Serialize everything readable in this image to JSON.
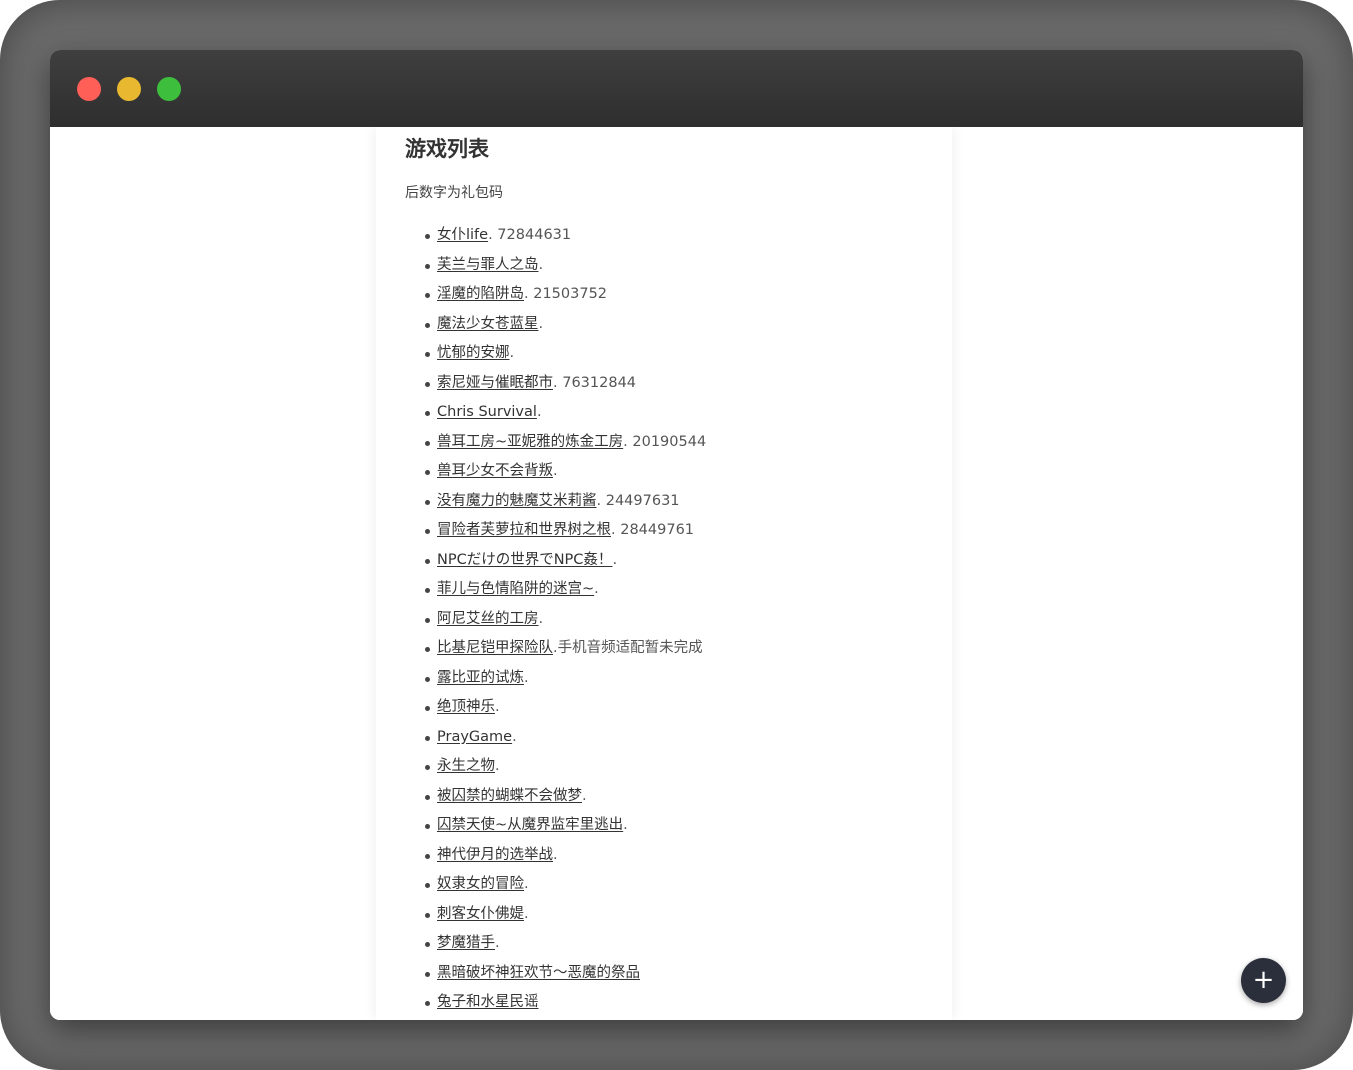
{
  "window": {
    "controls": [
      "close",
      "minimize",
      "maximize"
    ]
  },
  "content": {
    "heading": "游戏列表",
    "note": "后数字为礼包码",
    "games": [
      {
        "title": "女仆life",
        "suffix": ". 72844631"
      },
      {
        "title": "芙兰与罪人之岛",
        "suffix": "."
      },
      {
        "title": "淫魔的陷阱岛",
        "suffix": ". 21503752"
      },
      {
        "title": "魔法少女苍蓝星",
        "suffix": "."
      },
      {
        "title": "忧郁的安娜",
        "suffix": "."
      },
      {
        "title": "索尼娅与催眠都市",
        "suffix": ". 76312844"
      },
      {
        "title": "Chris Survival",
        "suffix": "."
      },
      {
        "title": "兽耳工房~亚妮雅的炼金工房",
        "suffix": ". 20190544"
      },
      {
        "title": "兽耳少女不会背叛",
        "suffix": "."
      },
      {
        "title": "没有魔力的魅魔艾米莉酱",
        "suffix": ". 24497631"
      },
      {
        "title": "冒险者芙萝拉和世界树之根",
        "suffix": ". 28449761"
      },
      {
        "title": "NPCだけの世界でNPC姦！",
        "suffix": "."
      },
      {
        "title": "菲儿与色情陷阱的迷宫~",
        "suffix": "."
      },
      {
        "title": "阿尼艾丝的工房",
        "suffix": "."
      },
      {
        "title": "比基尼铠甲探险队",
        "suffix": ".手机音频适配暂未完成"
      },
      {
        "title": "露比亚的试炼",
        "suffix": "."
      },
      {
        "title": "绝顶神乐",
        "suffix": "."
      },
      {
        "title": "PrayGame",
        "suffix": "."
      },
      {
        "title": "永生之物",
        "suffix": "."
      },
      {
        "title": "被囚禁的蝴蝶不会做梦",
        "suffix": "."
      },
      {
        "title": "囚禁天使~从魔界监牢里逃出",
        "suffix": "."
      },
      {
        "title": "神代伊月的选举战",
        "suffix": "."
      },
      {
        "title": "奴隶女的冒险",
        "suffix": "."
      },
      {
        "title": "刺客女仆佛媞",
        "suffix": "."
      },
      {
        "title": "梦魔猎手",
        "suffix": "."
      },
      {
        "title": "黑暗破坏神狂欢节～恶魔的祭品",
        "suffix": ""
      },
      {
        "title": "兔子和水星民谣",
        "suffix": ""
      }
    ]
  },
  "fab": {
    "icon": "plus-icon",
    "glyph": "+"
  }
}
